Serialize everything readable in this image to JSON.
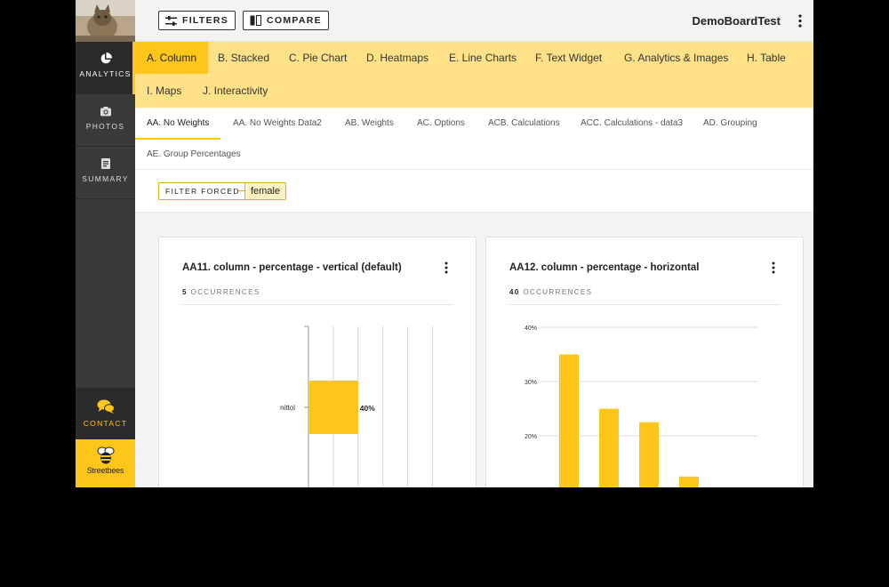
{
  "sidebar": {
    "items": [
      {
        "label": "ANALYTICS",
        "icon": "pie-chart-icon",
        "active": true
      },
      {
        "label": "PHOTOS",
        "icon": "camera-icon",
        "active": false
      },
      {
        "label": "SUMMARY",
        "icon": "document-icon",
        "active": false
      }
    ],
    "contact_label": "CONTACT",
    "brand_name": "Streetbees"
  },
  "topbar": {
    "filters_label": "FILTERS",
    "compare_label": "COMPARE",
    "board_name": "DemoBoardTest"
  },
  "tabs": [
    {
      "label": "A. Column",
      "active": true
    },
    {
      "label": "B. Stacked",
      "active": false
    },
    {
      "label": "C. Pie Chart",
      "active": false
    },
    {
      "label": "D. Heatmaps",
      "active": false
    },
    {
      "label": "E. Line Charts",
      "active": false
    },
    {
      "label": "F. Text Widget",
      "active": false
    },
    {
      "label": "G. Analytics & Images",
      "active": false
    },
    {
      "label": "H. Table",
      "active": false
    },
    {
      "label": "I. Maps",
      "active": false
    },
    {
      "label": "J. Interactivity",
      "active": false
    }
  ],
  "subtabs": [
    {
      "label": "AA. No Weights",
      "active": true
    },
    {
      "label": "AA. No Weights Data2",
      "active": false
    },
    {
      "label": "AB. Weights",
      "active": false
    },
    {
      "label": "AC. Options",
      "active": false
    },
    {
      "label": "ACB. Calculations",
      "active": false
    },
    {
      "label": "ACC. Calculations - data3",
      "active": false
    },
    {
      "label": "AD. Grouping",
      "active": false
    },
    {
      "label": "AE. Group Percentages",
      "active": false
    }
  ],
  "filter": {
    "forced_label": "FILTER FORCED",
    "chip_value": "female"
  },
  "cards": [
    {
      "title": "AA11. column - percentage - vertical (default)",
      "occurrences_count": "5",
      "occurrences_label": "OCCURRENCES"
    },
    {
      "title": "AA12. column - percentage - horizontal",
      "occurrences_count": "40",
      "occurrences_label": "OCCURRENCES"
    }
  ],
  "colors": {
    "accent": "#ffc61a",
    "tabbar": "#ffe187",
    "sidebar": "#3a3a3a"
  },
  "chart_data": [
    {
      "type": "bar",
      "orientation": "horizontal",
      "categories": [
        "nittol"
      ],
      "values": [
        40
      ],
      "value_labels": [
        "40%"
      ],
      "grid": true
    },
    {
      "type": "bar",
      "orientation": "vertical",
      "values": [
        35,
        25,
        22.5,
        12.5
      ],
      "ylim_visible": [
        20,
        40
      ],
      "yticks": [
        "40%",
        "30%",
        "20%"
      ],
      "grid": true
    }
  ]
}
